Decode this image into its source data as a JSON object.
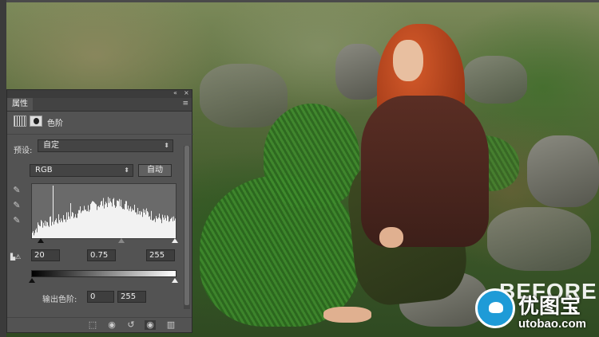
{
  "panel": {
    "tab_label": "属性",
    "collapse_icon": "«",
    "close_icon": "×",
    "menu_icon": "≡",
    "layer_title": "色阶",
    "preset_label": "预设:",
    "preset_value": "自定",
    "channel_value": "RGB",
    "auto_label": "自动",
    "clip_icon_text": "⚠",
    "input_black": "20",
    "input_gamma": "0.75",
    "input_white": "255",
    "output_label": "输出色阶:",
    "output_black": "0",
    "output_white": "255"
  },
  "histogram_levels": {
    "black": 20,
    "gamma": 0.75,
    "white": 255,
    "output_black": 0,
    "output_white": 255
  },
  "icons": {
    "eyedropper_black": "eyedropper-black-icon",
    "eyedropper_gray": "eyedropper-gray-icon",
    "eyedropper_white": "eyedropper-white-icon",
    "clip_to_layer": "clip-to-layer-icon",
    "view_previous": "view-previous-icon",
    "reset": "reset-icon",
    "visibility": "eye-icon",
    "delete": "trash-icon"
  },
  "overlay": {
    "before_text": "BEFORE",
    "watermark_title": "优图宝",
    "watermark_url": "utobao.com"
  }
}
